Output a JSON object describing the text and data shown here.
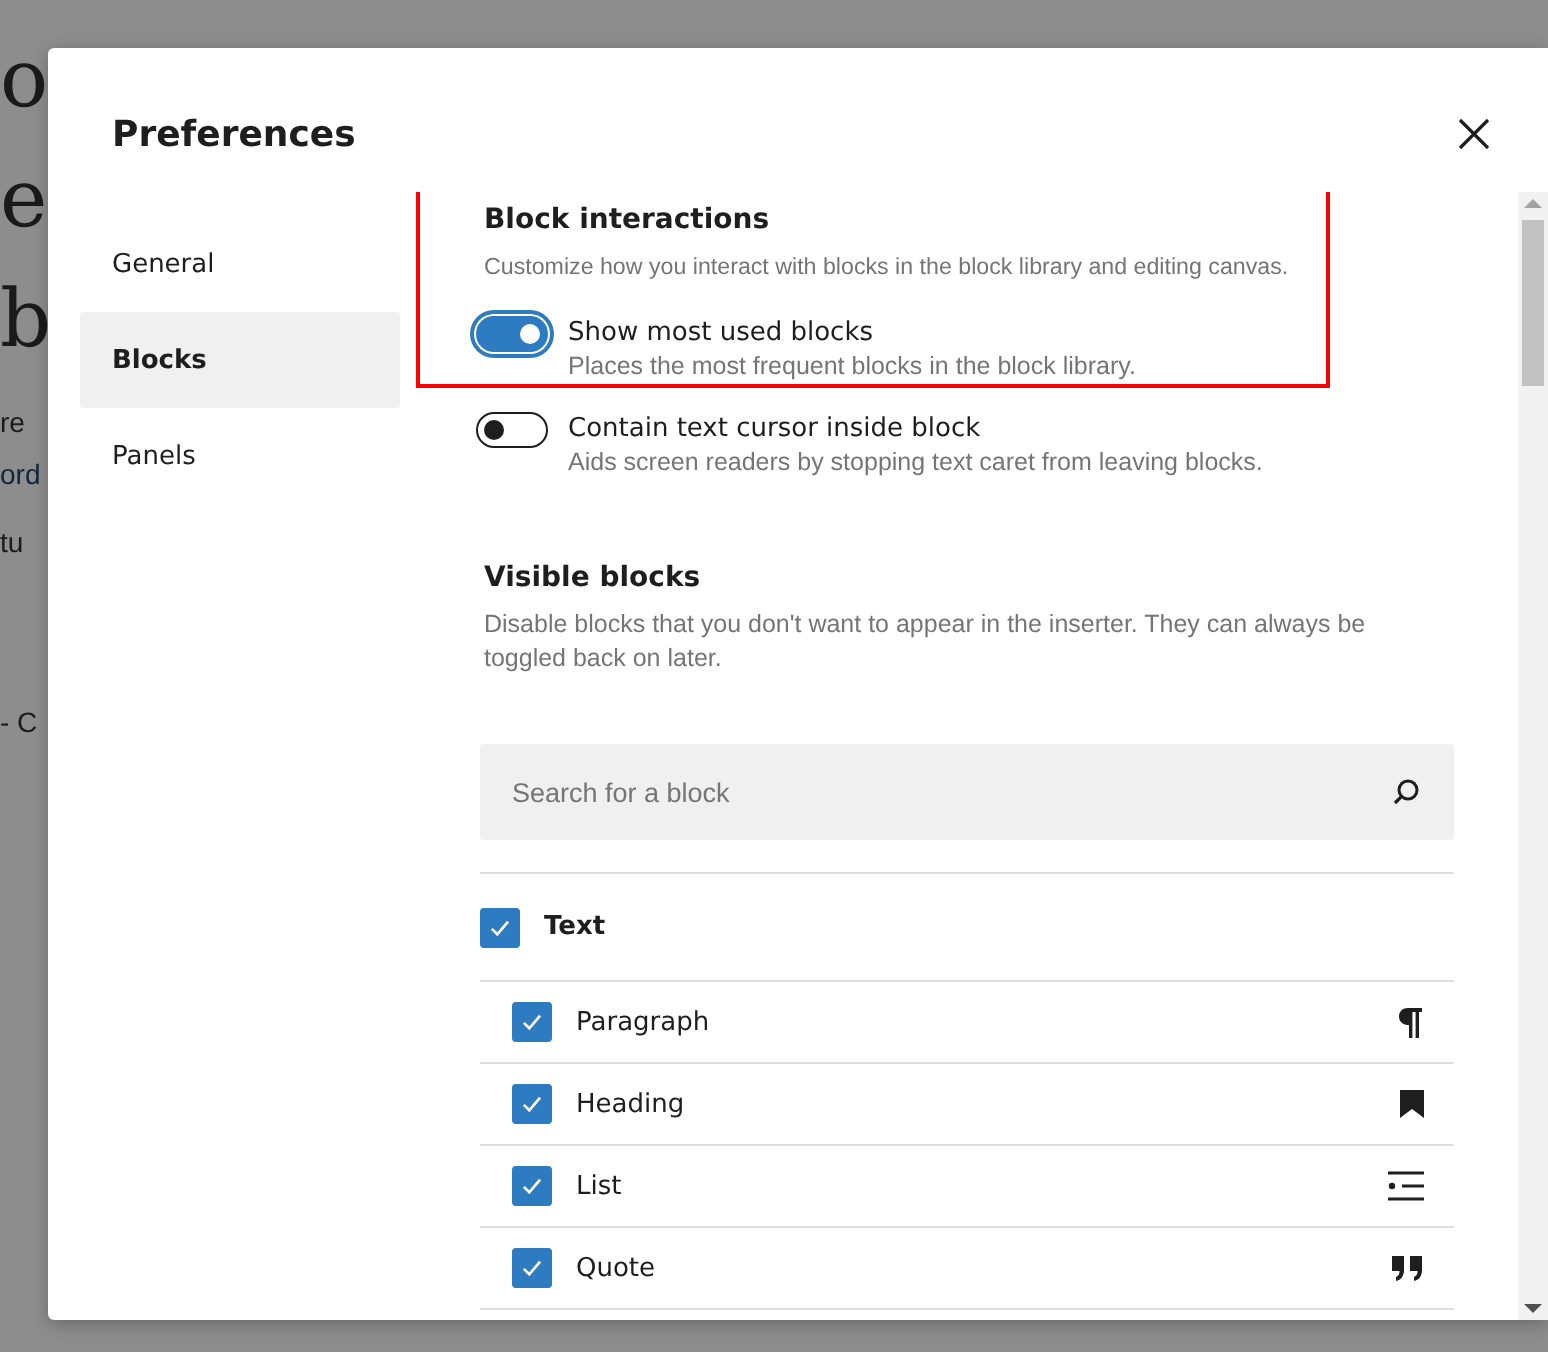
{
  "background_page": {
    "fragments": [
      {
        "kind": "heading",
        "text": "o"
      },
      {
        "kind": "heading",
        "text": "e"
      },
      {
        "kind": "heading",
        "text": "b"
      },
      {
        "kind": "body",
        "text": "re"
      },
      {
        "kind": "link",
        "text": "ord"
      },
      {
        "kind": "body",
        "text": "tu"
      },
      {
        "kind": "body",
        "text": "- C"
      }
    ]
  },
  "dialog": {
    "title": "Preferences",
    "tabs": [
      {
        "label": "General",
        "selected": false
      },
      {
        "label": "Blocks",
        "selected": true
      },
      {
        "label": "Panels",
        "selected": false
      }
    ],
    "block_interactions": {
      "title": "Block interactions",
      "description": "Customize how you interact with blocks in the block library and editing canvas.",
      "highlighted": true,
      "settings": [
        {
          "label": "Show most used blocks",
          "help": "Places the most frequent blocks in the block library.",
          "on": true
        },
        {
          "label": "Contain text cursor inside block",
          "help": "Aids screen readers by stopping text caret from leaving blocks.",
          "on": false
        }
      ]
    },
    "visible_blocks": {
      "title": "Visible blocks",
      "description": "Disable blocks that you don't want to appear in the inserter. They can always be toggled back on later.",
      "search": {
        "placeholder": "Search for a block"
      },
      "category": {
        "label": "Text",
        "checked": true,
        "blocks": [
          {
            "label": "Paragraph",
            "checked": true
          },
          {
            "label": "Heading",
            "checked": true
          },
          {
            "label": "List",
            "checked": true
          },
          {
            "label": "Quote",
            "checked": true
          }
        ]
      }
    }
  }
}
